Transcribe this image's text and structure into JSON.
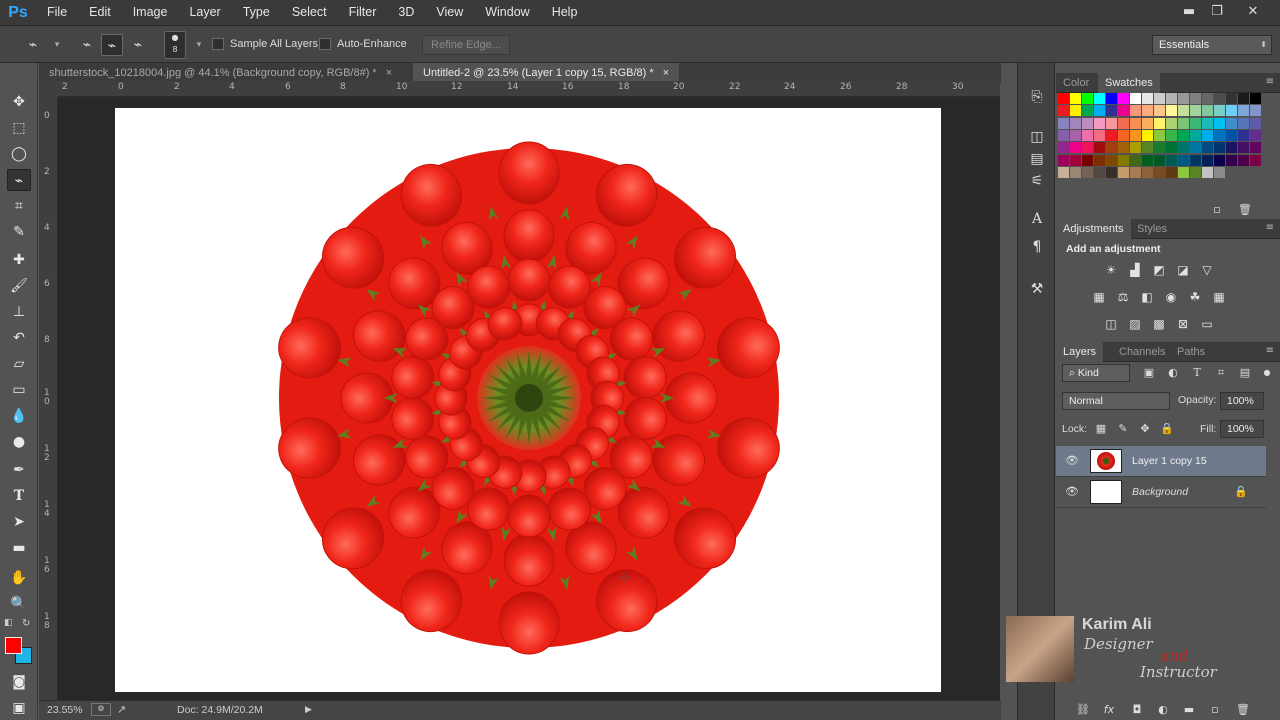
{
  "app": {
    "logo": "Ps"
  },
  "menu": [
    "File",
    "Edit",
    "Image",
    "Layer",
    "Type",
    "Select",
    "Filter",
    "3D",
    "View",
    "Window",
    "Help"
  ],
  "window_controls": {
    "minimize": "▬",
    "restore": "❐",
    "close": "✕"
  },
  "options": {
    "brush_size": "8",
    "sample_all_layers": "Sample All Layers",
    "auto_enhance": "Auto-Enhance",
    "refine_edge": "Refine Edge...",
    "workspace": "Essentials"
  },
  "tabs": [
    {
      "label": "shutterstock_10218004.jpg @ 44.1% (Background copy, RGB/8#) *",
      "close": "×"
    },
    {
      "label": "Untitled-2 @ 23.5% (Layer 1 copy 15, RGB/8) *",
      "close": "×"
    }
  ],
  "ruler": {
    "h": [
      "2",
      "0",
      "2",
      "4",
      "6",
      "8",
      "10",
      "12",
      "14",
      "16",
      "18",
      "20",
      "22",
      "24",
      "26",
      "28",
      "30"
    ],
    "v": [
      "0",
      "2",
      "4",
      "6",
      "8",
      "1\n0",
      "1\n2",
      "1\n4",
      "1\n6",
      "1\n8"
    ]
  },
  "status": {
    "zoom": "23.55%",
    "doc": "Doc: 24.9M/20.2M"
  },
  "colors": {
    "foreground": "#ff0000",
    "background": "#1fb5e6",
    "accent": "#31a8ff"
  },
  "swatches_panel": {
    "tab_color": "Color",
    "tab_swatches": "Swatches"
  },
  "adjustments_panel": {
    "tab_adjustments": "Adjustments",
    "tab_styles": "Styles",
    "heading": "Add an adjustment"
  },
  "layers_panel": {
    "tab_layers": "Layers",
    "tab_channels": "Channels",
    "tab_paths": "Paths",
    "filter_kind": "Kind",
    "blend_mode": "Normal",
    "opacity_label": "Opacity:",
    "opacity_value": "100%",
    "lock_label": "Lock:",
    "fill_label": "Fill:",
    "fill_value": "100%",
    "layers": [
      {
        "name": "Layer 1 copy 15",
        "selected": true
      },
      {
        "name": "Background",
        "selected": false,
        "locked": true
      }
    ]
  },
  "watermark": {
    "name": "Karim Ali",
    "line1": "Designer",
    "line2": "and",
    "line3": "Instructor"
  }
}
